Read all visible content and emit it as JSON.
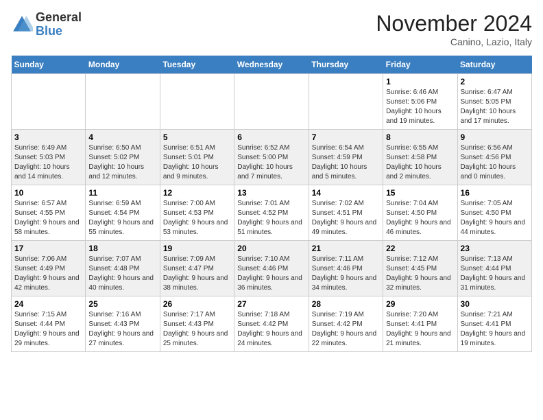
{
  "header": {
    "logo_general": "General",
    "logo_blue": "Blue",
    "month_title": "November 2024",
    "location": "Canino, Lazio, Italy"
  },
  "weekdays": [
    "Sunday",
    "Monday",
    "Tuesday",
    "Wednesday",
    "Thursday",
    "Friday",
    "Saturday"
  ],
  "weeks": [
    [
      {
        "day": "",
        "info": ""
      },
      {
        "day": "",
        "info": ""
      },
      {
        "day": "",
        "info": ""
      },
      {
        "day": "",
        "info": ""
      },
      {
        "day": "",
        "info": ""
      },
      {
        "day": "1",
        "info": "Sunrise: 6:46 AM\nSunset: 5:06 PM\nDaylight: 10 hours and 19 minutes."
      },
      {
        "day": "2",
        "info": "Sunrise: 6:47 AM\nSunset: 5:05 PM\nDaylight: 10 hours and 17 minutes."
      }
    ],
    [
      {
        "day": "3",
        "info": "Sunrise: 6:49 AM\nSunset: 5:03 PM\nDaylight: 10 hours and 14 minutes."
      },
      {
        "day": "4",
        "info": "Sunrise: 6:50 AM\nSunset: 5:02 PM\nDaylight: 10 hours and 12 minutes."
      },
      {
        "day": "5",
        "info": "Sunrise: 6:51 AM\nSunset: 5:01 PM\nDaylight: 10 hours and 9 minutes."
      },
      {
        "day": "6",
        "info": "Sunrise: 6:52 AM\nSunset: 5:00 PM\nDaylight: 10 hours and 7 minutes."
      },
      {
        "day": "7",
        "info": "Sunrise: 6:54 AM\nSunset: 4:59 PM\nDaylight: 10 hours and 5 minutes."
      },
      {
        "day": "8",
        "info": "Sunrise: 6:55 AM\nSunset: 4:58 PM\nDaylight: 10 hours and 2 minutes."
      },
      {
        "day": "9",
        "info": "Sunrise: 6:56 AM\nSunset: 4:56 PM\nDaylight: 10 hours and 0 minutes."
      }
    ],
    [
      {
        "day": "10",
        "info": "Sunrise: 6:57 AM\nSunset: 4:55 PM\nDaylight: 9 hours and 58 minutes."
      },
      {
        "day": "11",
        "info": "Sunrise: 6:59 AM\nSunset: 4:54 PM\nDaylight: 9 hours and 55 minutes."
      },
      {
        "day": "12",
        "info": "Sunrise: 7:00 AM\nSunset: 4:53 PM\nDaylight: 9 hours and 53 minutes."
      },
      {
        "day": "13",
        "info": "Sunrise: 7:01 AM\nSunset: 4:52 PM\nDaylight: 9 hours and 51 minutes."
      },
      {
        "day": "14",
        "info": "Sunrise: 7:02 AM\nSunset: 4:51 PM\nDaylight: 9 hours and 49 minutes."
      },
      {
        "day": "15",
        "info": "Sunrise: 7:04 AM\nSunset: 4:50 PM\nDaylight: 9 hours and 46 minutes."
      },
      {
        "day": "16",
        "info": "Sunrise: 7:05 AM\nSunset: 4:50 PM\nDaylight: 9 hours and 44 minutes."
      }
    ],
    [
      {
        "day": "17",
        "info": "Sunrise: 7:06 AM\nSunset: 4:49 PM\nDaylight: 9 hours and 42 minutes."
      },
      {
        "day": "18",
        "info": "Sunrise: 7:07 AM\nSunset: 4:48 PM\nDaylight: 9 hours and 40 minutes."
      },
      {
        "day": "19",
        "info": "Sunrise: 7:09 AM\nSunset: 4:47 PM\nDaylight: 9 hours and 38 minutes."
      },
      {
        "day": "20",
        "info": "Sunrise: 7:10 AM\nSunset: 4:46 PM\nDaylight: 9 hours and 36 minutes."
      },
      {
        "day": "21",
        "info": "Sunrise: 7:11 AM\nSunset: 4:46 PM\nDaylight: 9 hours and 34 minutes."
      },
      {
        "day": "22",
        "info": "Sunrise: 7:12 AM\nSunset: 4:45 PM\nDaylight: 9 hours and 32 minutes."
      },
      {
        "day": "23",
        "info": "Sunrise: 7:13 AM\nSunset: 4:44 PM\nDaylight: 9 hours and 31 minutes."
      }
    ],
    [
      {
        "day": "24",
        "info": "Sunrise: 7:15 AM\nSunset: 4:44 PM\nDaylight: 9 hours and 29 minutes."
      },
      {
        "day": "25",
        "info": "Sunrise: 7:16 AM\nSunset: 4:43 PM\nDaylight: 9 hours and 27 minutes."
      },
      {
        "day": "26",
        "info": "Sunrise: 7:17 AM\nSunset: 4:43 PM\nDaylight: 9 hours and 25 minutes."
      },
      {
        "day": "27",
        "info": "Sunrise: 7:18 AM\nSunset: 4:42 PM\nDaylight: 9 hours and 24 minutes."
      },
      {
        "day": "28",
        "info": "Sunrise: 7:19 AM\nSunset: 4:42 PM\nDaylight: 9 hours and 22 minutes."
      },
      {
        "day": "29",
        "info": "Sunrise: 7:20 AM\nSunset: 4:41 PM\nDaylight: 9 hours and 21 minutes."
      },
      {
        "day": "30",
        "info": "Sunrise: 7:21 AM\nSunset: 4:41 PM\nDaylight: 9 hours and 19 minutes."
      }
    ]
  ]
}
